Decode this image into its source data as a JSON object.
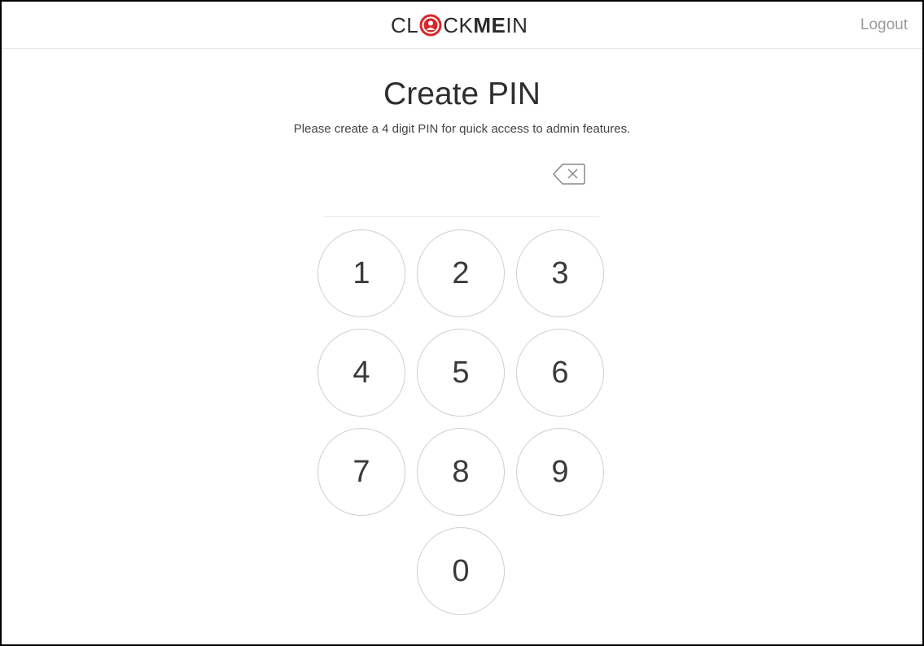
{
  "header": {
    "logo": {
      "part1": "CL",
      "part2": "CK",
      "part3": "ME",
      "part4": "IN",
      "mark_color": "#d9262b"
    },
    "logout_label": "Logout"
  },
  "main": {
    "title": "Create PIN",
    "subtitle": "Please create a 4 digit PIN for quick access to admin features.",
    "pin_value": ""
  },
  "keypad": {
    "keys": [
      "1",
      "2",
      "3",
      "4",
      "5",
      "6",
      "7",
      "8",
      "9",
      "0"
    ]
  },
  "colors": {
    "accent": "#d9262b",
    "text": "#333333",
    "muted": "#9a9a9a",
    "border": "#cfcfcf"
  },
  "icons": {
    "backspace": "backspace-icon",
    "logo_mark": "clock-person-icon"
  }
}
